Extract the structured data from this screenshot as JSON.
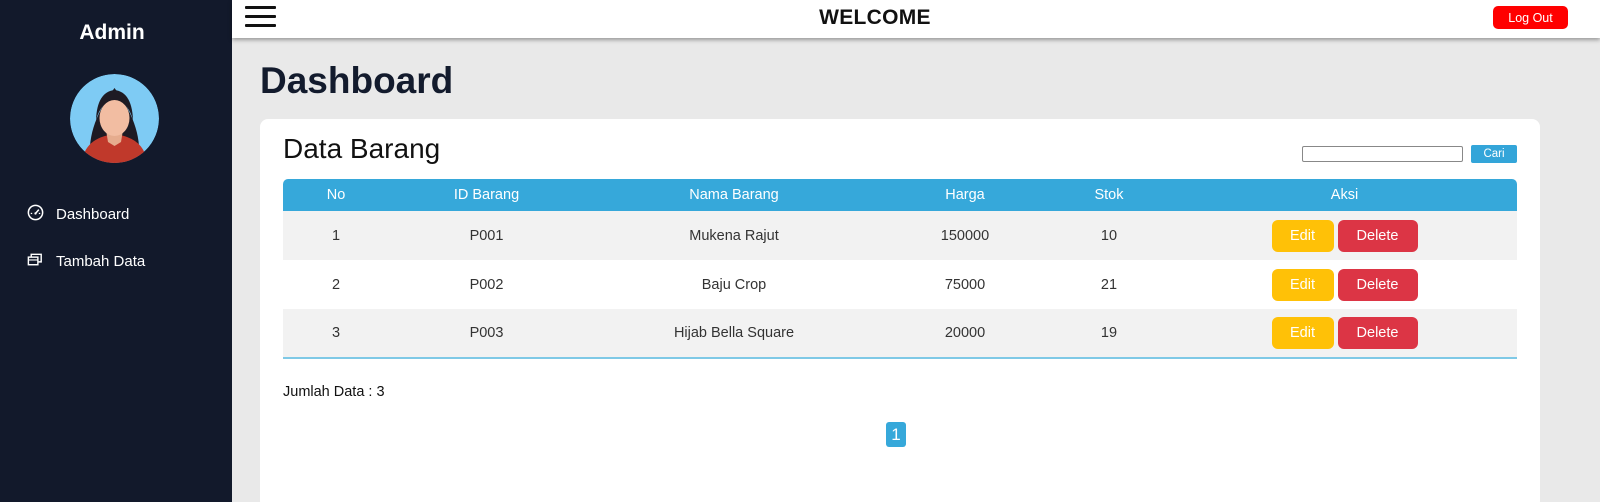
{
  "sidebar": {
    "title": "Admin",
    "items": [
      {
        "label": "Dashboard",
        "icon": "gauge-icon"
      },
      {
        "label": "Tambah Data",
        "icon": "boxes-icon"
      }
    ]
  },
  "topbar": {
    "welcome": "WELCOME",
    "logout_label": "Log Out"
  },
  "page": {
    "title": "Dashboard"
  },
  "card": {
    "title": "Data Barang",
    "search": {
      "placeholder": "",
      "value": "",
      "button_label": "Cari"
    },
    "columns": [
      "No",
      "ID Barang",
      "Nama Barang",
      "Harga",
      "Stok",
      "Aksi"
    ],
    "rows": [
      {
        "no": "1",
        "id": "P001",
        "name": "Mukena Rajut",
        "harga": "150000",
        "stok": "10",
        "edit": "Edit",
        "delete": "Delete"
      },
      {
        "no": "2",
        "id": "P002",
        "name": "Baju Crop",
        "harga": "75000",
        "stok": "21",
        "edit": "Edit",
        "delete": "Delete"
      },
      {
        "no": "3",
        "id": "P003",
        "name": "Hijab Bella Square",
        "harga": "20000",
        "stok": "19",
        "edit": "Edit",
        "delete": "Delete"
      }
    ],
    "jumlah": "Jumlah Data : 3",
    "pagination": {
      "current": "1"
    }
  },
  "colors": {
    "sidebar_bg": "#12192b",
    "header_blue": "#36a8da",
    "logout_red": "#ff0000",
    "edit_yellow": "#ffc107",
    "delete_red": "#dc3545"
  }
}
